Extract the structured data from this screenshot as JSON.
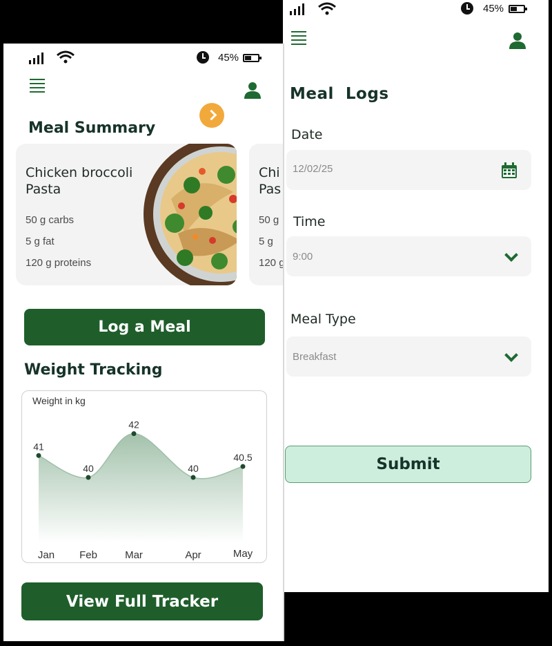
{
  "status_bar": {
    "battery": "45%"
  },
  "summary_screen": {
    "title": "Meal Summary",
    "meal_card": {
      "name": "Chicken broccoli Pasta",
      "nutrients": [
        "50 g carbs",
        "5 g fat",
        "120 g proteins"
      ]
    },
    "peek_card": {
      "name": "Chi\nPas",
      "nutrients": [
        "50 g",
        "5 g",
        "120 g"
      ]
    },
    "log_meal_button": "Log a Meal",
    "weight_title": "Weight Tracking",
    "view_tracker_button": "View Full Tracker"
  },
  "chart_data": {
    "type": "area",
    "ylabel": "Weight in kg",
    "categories": [
      "Jan",
      "Feb",
      "Mar",
      "Apr",
      "May"
    ],
    "values": [
      41,
      40,
      42,
      40,
      40.5
    ],
    "data_labels": [
      "41",
      "40",
      "42",
      "40",
      "40.5"
    ],
    "ylim": [
      37,
      43
    ],
    "grid": false,
    "fill_color": "#9fbfa8",
    "line_color": "#1f4a2e"
  },
  "log_screen": {
    "title": "Meal  Logs",
    "date": {
      "label": "Date",
      "value": "12/02/25"
    },
    "time": {
      "label": "Time",
      "value": "9:00"
    },
    "meal_type": {
      "label": "Meal Type",
      "value": "Breakfast"
    },
    "submit_button": "Submit"
  },
  "colors": {
    "brand_green": "#1f5e2b",
    "accent_orange": "#f2a93b",
    "submit_bg": "#cdeedd"
  }
}
